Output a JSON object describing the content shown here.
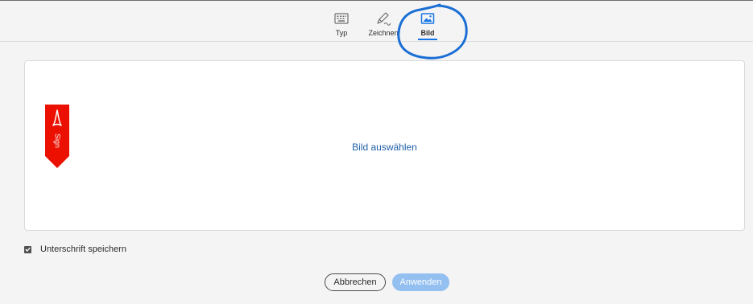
{
  "tabs": [
    {
      "label": "Typ",
      "icon": "keyboard-icon",
      "selected": false
    },
    {
      "label": "Zeichnen",
      "icon": "pen-icon",
      "selected": false
    },
    {
      "label": "Bild",
      "icon": "image-icon",
      "selected": true
    }
  ],
  "canvas": {
    "select_image_label": "Bild auswählen",
    "logo_text": "Sign"
  },
  "save_signature": {
    "label": "Unterschrift speichern",
    "checked": true
  },
  "buttons": {
    "cancel_label": "Abbrechen",
    "apply_label": "Anwenden"
  },
  "colors": {
    "accent": "#1473e6",
    "link": "#1d5fa9",
    "apply_disabled": "#93bff1",
    "brand_red": "#eb1000",
    "annotation_circle": "#1b6fd4"
  }
}
